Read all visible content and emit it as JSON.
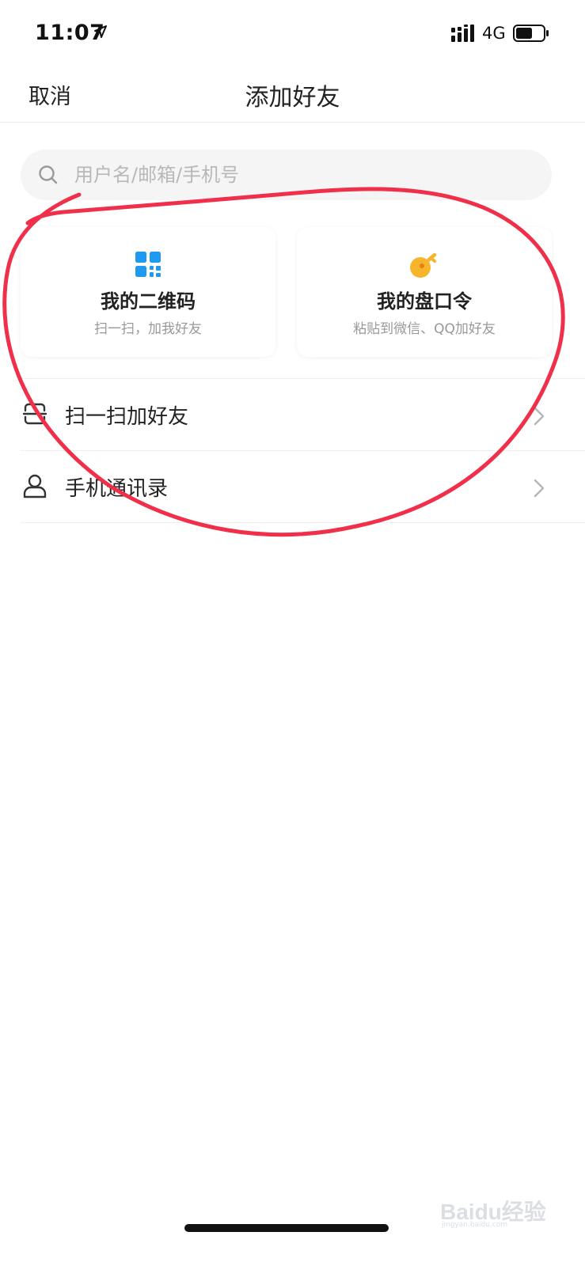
{
  "status_bar": {
    "time": "11:07",
    "network": "4G"
  },
  "nav": {
    "cancel_label": "取消",
    "title": "添加好友"
  },
  "search": {
    "placeholder": "用户名/邮箱/手机号"
  },
  "cards": [
    {
      "title": "我的二维码",
      "subtitle": "扫一扫，加我好友",
      "icon": "qr-code-icon",
      "color": "#1E9BF0"
    },
    {
      "title": "我的盘口令",
      "subtitle": "粘贴到微信、QQ加好友",
      "icon": "key-icon",
      "color": "#F7B52C"
    }
  ],
  "list": [
    {
      "label": "扫一扫加好友",
      "icon": "scan-icon"
    },
    {
      "label": "手机通讯录",
      "icon": "contacts-icon"
    }
  ],
  "watermark": {
    "brand": "Baidu经验",
    "url": "jingyan.baidu.com"
  },
  "colors": {
    "annotation": "#F0304A",
    "accent_blue": "#1E9BF0",
    "accent_yellow": "#F7B52C"
  }
}
